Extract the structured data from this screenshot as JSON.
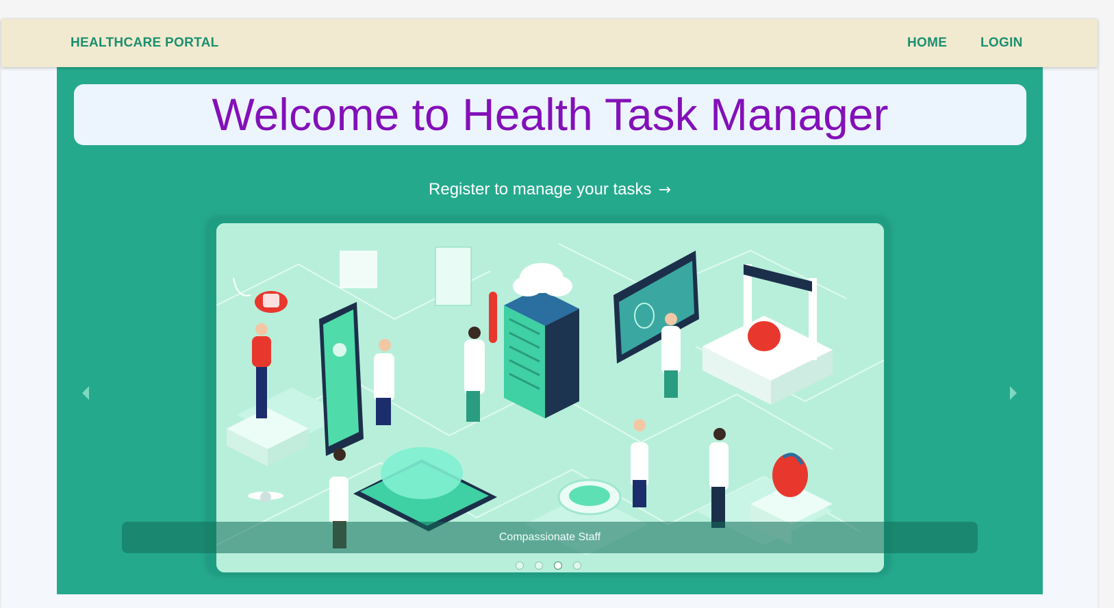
{
  "navbar": {
    "brand": "HEALTHCARE PORTAL",
    "links": [
      "HOME",
      "LOGIN"
    ]
  },
  "hero": {
    "title": "Welcome to Health Task Manager",
    "register_text": "Register to manage your tasks",
    "register_arrow": "→"
  },
  "carousel": {
    "caption": "Compassionate Staff",
    "slide_count": 4,
    "active_index": 2
  },
  "colors": {
    "brand": "#1b8f6f",
    "navbar_bg": "#f2ead0",
    "main_bg": "#25a98d",
    "title_text": "#8310b8",
    "welcome_bg": "#ecf5fd"
  }
}
